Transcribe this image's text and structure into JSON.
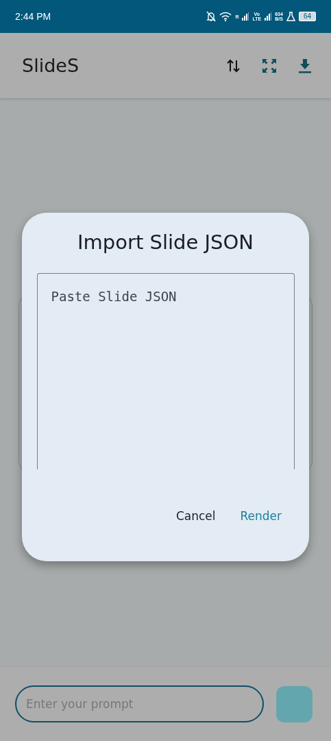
{
  "status_bar": {
    "time": "2:44 PM",
    "roaming": "R",
    "volte": "Vo\nLTE",
    "speed": "634",
    "speed_unit": "B/S",
    "battery": "64"
  },
  "app_bar": {
    "title": "SlideS"
  },
  "dialog": {
    "title": "Import Slide JSON",
    "field": {
      "placeholder": "Paste Slide JSON"
    },
    "buttons": [
      {
        "label": "Cancel",
        "kind": "plain"
      },
      {
        "label": "Render",
        "kind": "primary"
      }
    ]
  },
  "prompt": {
    "placeholder": "Enter your prompt"
  }
}
